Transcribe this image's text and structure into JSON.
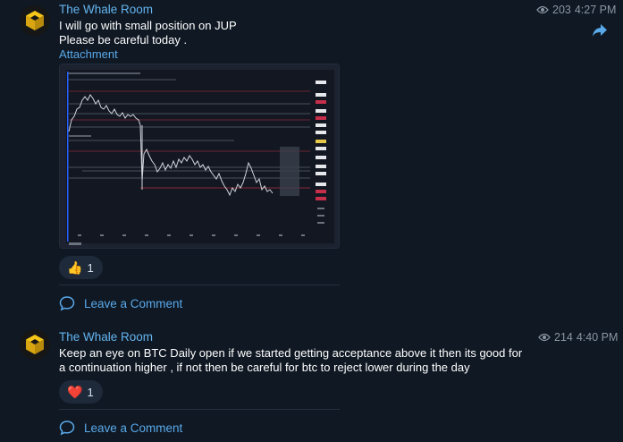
{
  "messages": [
    {
      "sender": "The Whale Room",
      "views": "203",
      "time": "4:27 PM",
      "text": "I will go with small position on JUP\nPlease be careful today .",
      "attachment_label": "Attachment",
      "reaction": {
        "emoji": "👍",
        "count": "1"
      },
      "comment_label": "Leave a Comment"
    },
    {
      "sender": "The Whale Room",
      "views": "214",
      "time": "4:40 PM",
      "text": "Keep an eye on BTC Daily open if we started getting acceptance above it then its good for\na continuation higher , if not then be careful for btc to reject lower during the day",
      "reaction": {
        "emoji": "❤️",
        "count": "1"
      },
      "comment_label": "Leave a Comment"
    }
  ],
  "icons": {
    "avatar": "whale-room-logo",
    "views": "eye-icon",
    "share": "share-arrow-icon",
    "comment": "comment-bubble-icon"
  },
  "colors": {
    "background": "#0f1823",
    "sender": "#64b5ef",
    "link": "#5aa9ea",
    "meta": "#8a96a3",
    "reaction_bg": "#1e2a3a"
  }
}
